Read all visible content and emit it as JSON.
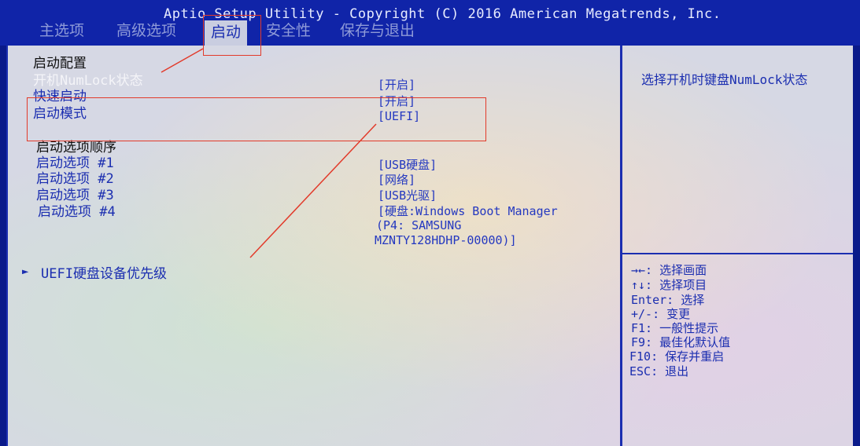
{
  "header": {
    "title": "Aptio Setup Utility - Copyright (C) 2016 American Megatrends, Inc.",
    "tabs": [
      {
        "label": "主选项"
      },
      {
        "label": "高级选项"
      },
      {
        "label": "启动"
      },
      {
        "label": "安全性"
      },
      {
        "label": "保存与退出"
      }
    ]
  },
  "boot": {
    "section_title": "启动配置",
    "numlock": {
      "label": "开机NumLock状态",
      "value": "[开启]"
    },
    "fast_boot": {
      "label": "快速启动",
      "value": "[开启]"
    },
    "boot_mode": {
      "label": "启动模式",
      "value": "[UEFI]"
    },
    "order_title": "启动选项顺序",
    "options": [
      {
        "label": "启动选项 #1",
        "value": "[USB硬盘]"
      },
      {
        "label": "启动选项 #2",
        "value": "[网络]"
      },
      {
        "label": "启动选项 #3",
        "value": "[USB光驱]"
      },
      {
        "label": "启动选项 #4",
        "value_lines": [
          "[硬盘:Windows Boot Manager",
          "(P4: SAMSUNG",
          "MZNTY128HDHP-00000)]"
        ]
      }
    ],
    "submenu": "UEFI硬盘设备优先级"
  },
  "help": {
    "description": "选择开机时键盘NumLock状态",
    "keys": [
      "→←: 选择画面",
      "↑↓: 选择项目",
      "Enter: 选择",
      "+/-: 变更",
      "F1: 一般性提示",
      "F9: 最佳化默认值",
      "F10: 保存并重启",
      "ESC: 退出"
    ]
  },
  "colors": {
    "header_bg": "#1024a8",
    "text_blue": "#1b2eb0",
    "annotation": "#e23a2a"
  }
}
